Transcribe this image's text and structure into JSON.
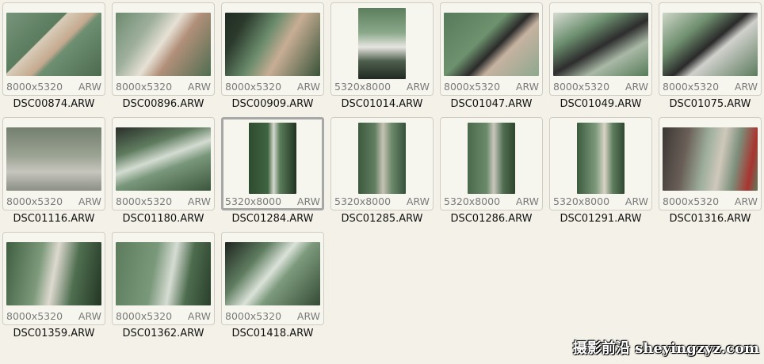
{
  "files": [
    {
      "name": "DSC00874.ARW",
      "dims": "8000x5320",
      "ext": "ARW",
      "orientation": "landscape",
      "swatch": "p-a"
    },
    {
      "name": "DSC00896.ARW",
      "dims": "8000x5320",
      "ext": "ARW",
      "orientation": "landscape",
      "swatch": "p-b"
    },
    {
      "name": "DSC00909.ARW",
      "dims": "8000x5320",
      "ext": "ARW",
      "orientation": "landscape",
      "swatch": "p-c"
    },
    {
      "name": "DSC01014.ARW",
      "dims": "5320x8000",
      "ext": "ARW",
      "orientation": "portrait",
      "swatch": "p-d"
    },
    {
      "name": "DSC01047.ARW",
      "dims": "8000x5320",
      "ext": "ARW",
      "orientation": "landscape",
      "swatch": "p-e"
    },
    {
      "name": "DSC01049.ARW",
      "dims": "8000x5320",
      "ext": "ARW",
      "orientation": "landscape",
      "swatch": "p-f"
    },
    {
      "name": "DSC01075.ARW",
      "dims": "8000x5320",
      "ext": "ARW",
      "orientation": "landscape",
      "swatch": "p-g"
    },
    {
      "name": "DSC01116.ARW",
      "dims": "8000x5320",
      "ext": "ARW",
      "orientation": "landscape",
      "swatch": "p-h"
    },
    {
      "name": "DSC01180.ARW",
      "dims": "8000x5320",
      "ext": "ARW",
      "orientation": "landscape",
      "swatch": "p-i"
    },
    {
      "name": "DSC01284.ARW",
      "dims": "5320x8000",
      "ext": "ARW",
      "orientation": "portrait",
      "swatch": "p-j",
      "selected": true
    },
    {
      "name": "DSC01285.ARW",
      "dims": "5320x8000",
      "ext": "ARW",
      "orientation": "portrait",
      "swatch": "p-k"
    },
    {
      "name": "DSC01286.ARW",
      "dims": "5320x8000",
      "ext": "ARW",
      "orientation": "portrait",
      "swatch": "p-l"
    },
    {
      "name": "DSC01291.ARW",
      "dims": "5320x8000",
      "ext": "ARW",
      "orientation": "portrait",
      "swatch": "p-m"
    },
    {
      "name": "DSC01316.ARW",
      "dims": "8000x5320",
      "ext": "ARW",
      "orientation": "landscape",
      "swatch": "p-n"
    },
    {
      "name": "DSC01359.ARW",
      "dims": "8000x5320",
      "ext": "ARW",
      "orientation": "landscape",
      "swatch": "p-o"
    },
    {
      "name": "DSC01362.ARW",
      "dims": "8000x5320",
      "ext": "ARW",
      "orientation": "landscape",
      "swatch": "p-p"
    },
    {
      "name": "DSC01418.ARW",
      "dims": "8000x5320",
      "ext": "ARW",
      "orientation": "landscape",
      "swatch": "p-q"
    }
  ],
  "watermark": "摄影前沿 sheyingzyz.com",
  "colors": {
    "background": "#f4f2e8",
    "tile_border": "#cfccc3",
    "selected_border": "#a7a7a7",
    "meta_text": "#7a7a7a",
    "name_text": "#111111"
  }
}
